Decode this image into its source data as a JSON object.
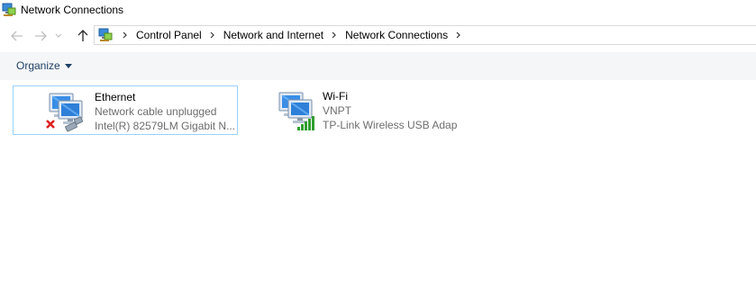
{
  "window": {
    "title": "Network Connections",
    "icon": "network-connections-icon"
  },
  "nav": {
    "back_icon": "back-arrow-icon",
    "forward_icon": "forward-arrow-icon",
    "recent_icon": "chevron-down-icon",
    "up_icon": "up-arrow-icon"
  },
  "address": {
    "crumbs": [
      "Control Panel",
      "Network and Internet",
      "Network Connections"
    ]
  },
  "toolbar": {
    "organize_label": "Organize"
  },
  "connections": [
    {
      "name": "Ethernet",
      "status": "Network cable unplugged",
      "adapter": "Intel(R) 82579LM Gigabit N...",
      "icon": "ethernet-disconnected-icon",
      "selected": true
    },
    {
      "name": "Wi-Fi",
      "status": "VNPT",
      "adapter": "TP-Link Wireless USB Adap",
      "icon": "wifi-connected-icon",
      "selected": false
    }
  ],
  "colors": {
    "toolbar_bg": "#f5f6f7",
    "selection_border": "#99d1ff",
    "organize_text": "#1e3f66",
    "subtext": "#6d6d6d"
  }
}
